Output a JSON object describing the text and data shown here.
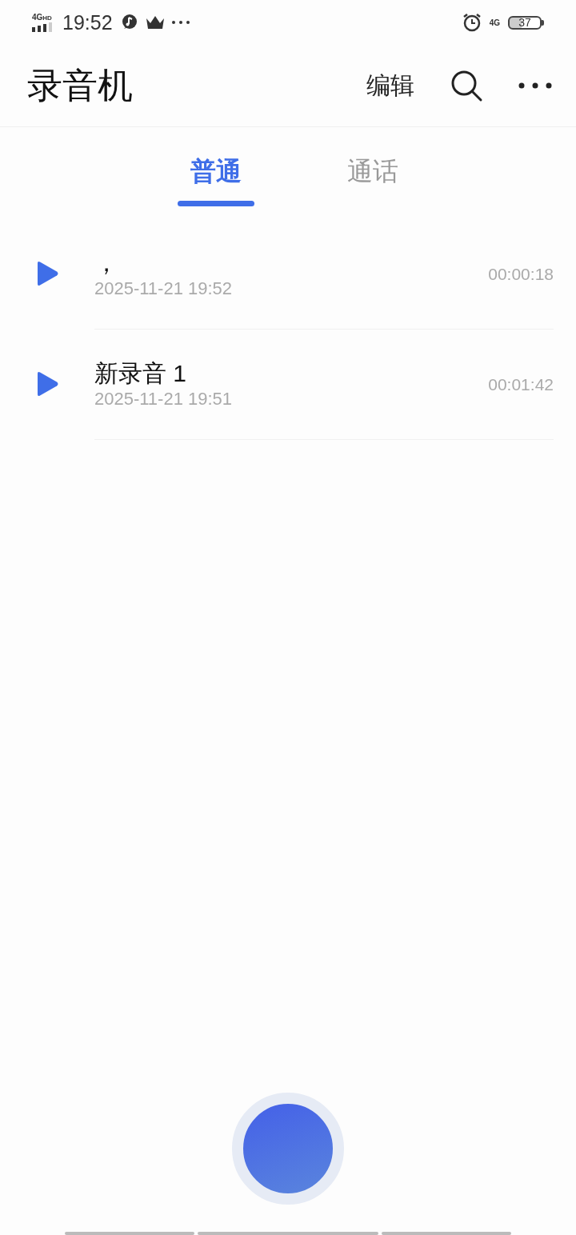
{
  "status_bar": {
    "network": "4G",
    "network_badge": "HD",
    "time": "19:52",
    "mobile_data": "4G",
    "battery": "37"
  },
  "header": {
    "title": "录音机",
    "edit": "编辑"
  },
  "tabs": [
    {
      "label": "普通",
      "selected": true
    },
    {
      "label": "通话",
      "selected": false
    }
  ],
  "recordings": [
    {
      "name": "，",
      "date": "2025-11-21 19:52",
      "duration": "00:00:18"
    },
    {
      "name": "新录音 1",
      "date": "2025-11-21 19:51",
      "duration": "00:01:42"
    }
  ]
}
